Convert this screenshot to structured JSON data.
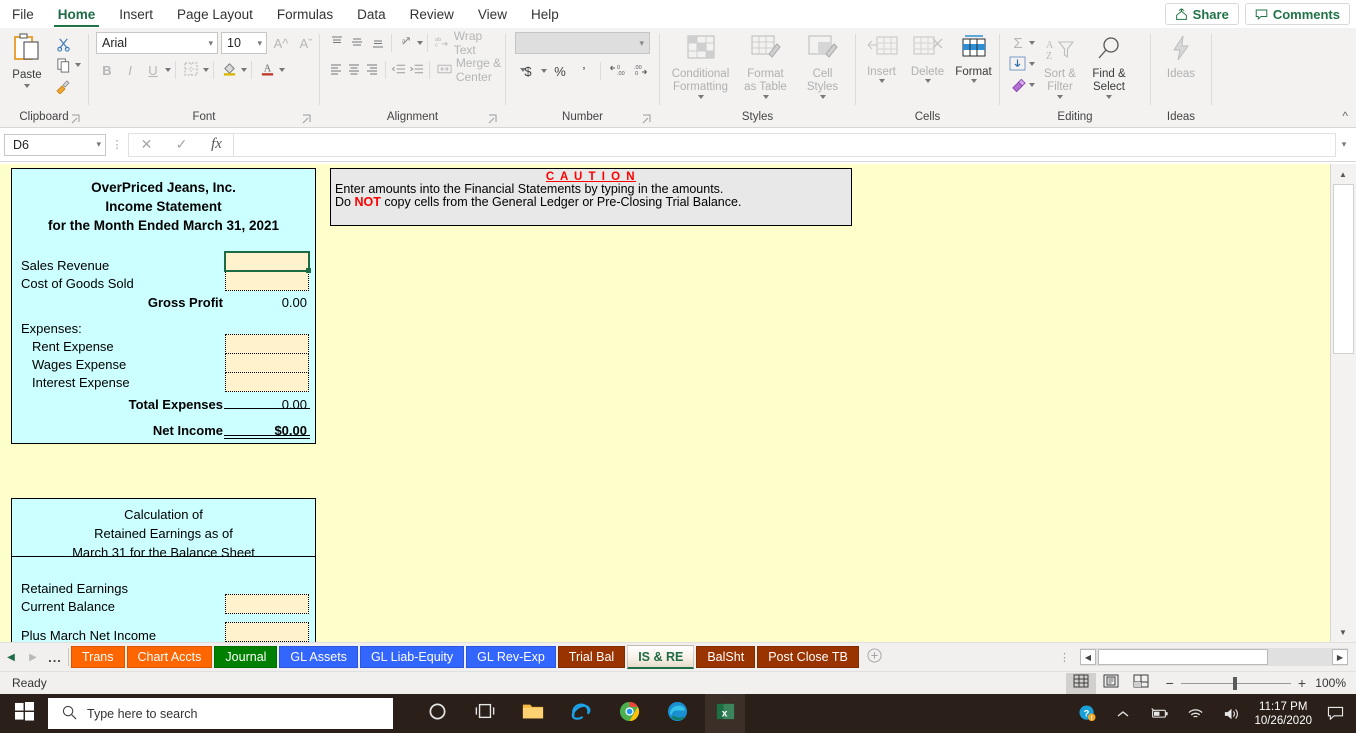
{
  "window": {
    "ribbon_tabs": [
      "File",
      "Home",
      "Insert",
      "Page Layout",
      "Formulas",
      "Data",
      "Review",
      "View",
      "Help"
    ],
    "active_ribbon_tab": "Home",
    "share_label": "Share",
    "comments_label": "Comments"
  },
  "ribbon": {
    "groups": [
      {
        "name": "Clipboard",
        "label": "Clipboard"
      },
      {
        "name": "Font",
        "label": "Font"
      },
      {
        "name": "Alignment",
        "label": "Alignment"
      },
      {
        "name": "Number",
        "label": "Number"
      },
      {
        "name": "Styles",
        "label": "Styles"
      },
      {
        "name": "Cells",
        "label": "Cells"
      },
      {
        "name": "Editing",
        "label": "Editing"
      },
      {
        "name": "Ideas",
        "label": "Ideas"
      }
    ],
    "clipboard": {
      "paste": "Paste",
      "cut": "cut-icon",
      "copy": "copy-icon",
      "format_painter": "format-painter-icon"
    },
    "font": {
      "family_value": "Arial",
      "size_value": "10",
      "grow": "A^",
      "shrink": "Aˇ",
      "bold": "B",
      "italic": "I",
      "underline": "U",
      "borders": "borders-icon",
      "fill": "fill-color-icon",
      "font_color": "font-color-icon"
    },
    "alignment": {
      "wrap_text": "Wrap Text",
      "merge_center": "Merge & Center"
    },
    "number": {
      "format_value": "",
      "currency": "$",
      "percent": "%",
      "comma": "’",
      "inc_dec": ".00",
      "dec_dec": ".00"
    },
    "styles": {
      "conditional": "Conditional Formatting",
      "format_table": "Format as Table",
      "cell_styles": "Cell Styles"
    },
    "cells": {
      "insert": "Insert",
      "delete": "Delete",
      "format": "Format"
    },
    "editing": {
      "autosum": "Σ",
      "fill": "fill-down-icon",
      "clear": "clear-icon",
      "sort_filter": "Sort & Filter",
      "find_select": "Find & Select"
    },
    "ideas": {
      "label": "Ideas"
    }
  },
  "formula_bar": {
    "name_box_value": "D6",
    "cancel": "✕",
    "confirm": "✓",
    "fx": "fx",
    "formula_value": ""
  },
  "income_statement": {
    "title_line1": "OverPriced Jeans, Inc.",
    "title_line2": "Income Statement",
    "title_line3": "for the Month Ended March 31, 2021",
    "rows": [
      {
        "label": "Sales Revenue",
        "value": "",
        "type": "input-selected"
      },
      {
        "label": "Cost of Goods Sold",
        "value": "",
        "type": "input"
      },
      {
        "label": "Gross Profit",
        "value": "0.00",
        "type": "total"
      },
      {
        "label": "Expenses:",
        "value": "",
        "type": "header"
      },
      {
        "label": "Rent Expense",
        "value": "",
        "type": "input"
      },
      {
        "label": "Wages Expense",
        "value": "",
        "type": "input"
      },
      {
        "label": "Interest Expense",
        "value": "",
        "type": "input"
      },
      {
        "label": "Total Expenses",
        "value": "0.00",
        "type": "total"
      },
      {
        "label": "Net Income",
        "value": "$0.00",
        "type": "grand-total"
      }
    ]
  },
  "retained_earnings": {
    "title_line1": "Calculation of",
    "title_line2": "Retained Earnings as of",
    "title_line3": "March 31 for the Balance Sheet",
    "rows": [
      {
        "label": "Retained Earnings",
        "value": "",
        "type": "text"
      },
      {
        "label": "Current Balance",
        "value": "",
        "type": "input"
      },
      {
        "label": "Plus March Net Income",
        "value": "",
        "type": "input"
      }
    ]
  },
  "caution": {
    "title": "C A U T I O N",
    "line1": "Enter amounts into the Financial Statements by typing in the amounts.",
    "line2_before": "Do ",
    "line2_emphasis": "NOT",
    "line2_after": " copy cells from the General Ledger or Pre-Closing Trial Balance."
  },
  "sheet_tabs": {
    "items": [
      {
        "label": "Trans",
        "color": "#FF6600",
        "active": false
      },
      {
        "label": "Chart Accts",
        "color": "#FF6600",
        "active": false
      },
      {
        "label": "Journal",
        "color": "#008000",
        "active": false
      },
      {
        "label": "GL Assets",
        "color": "#3366FF",
        "active": false
      },
      {
        "label": "GL Liab-Equity",
        "color": "#3366FF",
        "active": false
      },
      {
        "label": "GL Rev-Exp",
        "color": "#3366FF",
        "active": false
      },
      {
        "label": "Trial Bal",
        "color": "#993300",
        "active": false
      },
      {
        "label": "IS & RE",
        "color": "#993300",
        "active": true
      },
      {
        "label": "BalSht",
        "color": "#993300",
        "active": false
      },
      {
        "label": "Post Close TB",
        "color": "#993300",
        "active": false
      }
    ],
    "add_sheet": "+",
    "nav_prev": "◀",
    "nav_next": "▶",
    "nav_more": "..."
  },
  "status_bar": {
    "status_text": "Ready",
    "view_normal": "normal-view-icon",
    "view_page_layout": "page-layout-view-icon",
    "view_page_break": "page-break-view-icon",
    "zoom_out": "−",
    "zoom_in": "+",
    "zoom_level": "100%"
  },
  "taskbar": {
    "start": "windows-start-icon",
    "search_placeholder": "Type here to search",
    "icons": [
      "cortana-icon",
      "task-view-icon",
      "file-explorer-icon",
      "internet-explorer-icon",
      "chrome-icon",
      "edge-icon",
      "excel-icon"
    ],
    "tray": {
      "help": "help-icon",
      "chevron": "show-hidden-icons-icon",
      "battery": "battery-icon",
      "network": "wifi-icon",
      "volume": "volume-icon",
      "time": "11:17 PM",
      "date": "10/26/2020",
      "notifications": "notification-center-icon"
    }
  }
}
